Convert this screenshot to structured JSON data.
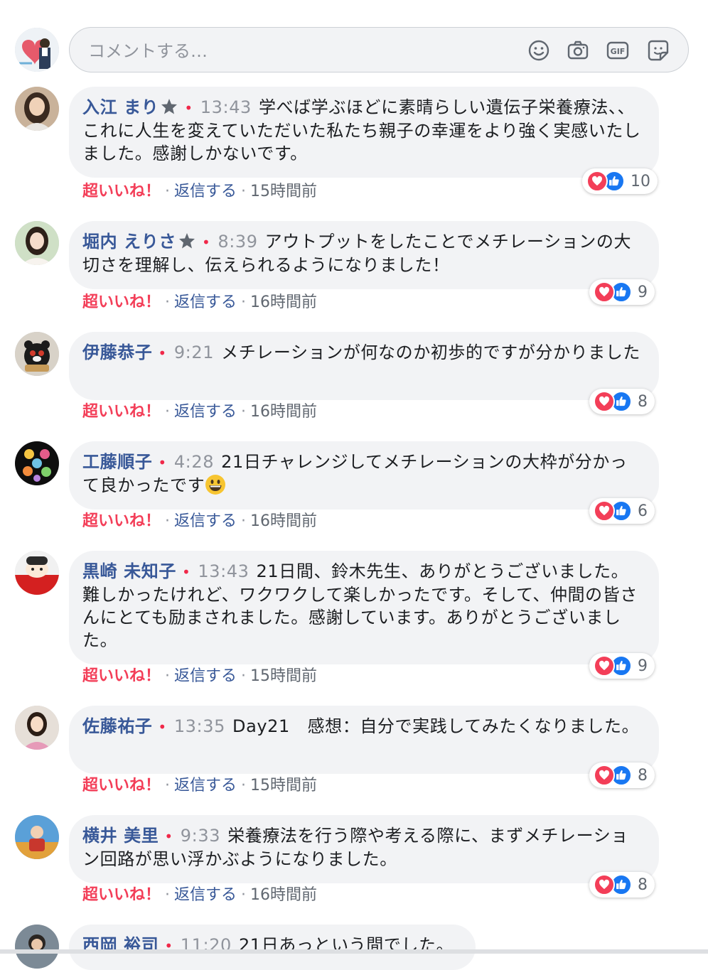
{
  "composer": {
    "placeholder": "コメントする…"
  },
  "comments": [
    {
      "name": "入江 まり",
      "time": "13:43",
      "text": "学べば学ぶほどに素晴らしい遺伝子栄養療法、、これに人生を変えていただいた私たち親子の幸運をより強く実感いたしました。感謝しかないです。",
      "love_label": "超いいね！",
      "reply_label": "返信する",
      "ago": "15時間前",
      "reaction_count": "10"
    },
    {
      "name": "堀内 えりさ",
      "time": "8:39",
      "text": "アウトプットをしたことでメチレーションの大切さを理解し、伝えられるようになりました！",
      "love_label": "超いいね！",
      "reply_label": "返信する",
      "ago": "16時間前",
      "reaction_count": "9"
    },
    {
      "name": "伊藤恭子",
      "time": "9:21",
      "text": "メチレーションが何なのか初歩的ですが分かりました",
      "love_label": "超いいね！",
      "reply_label": "返信する",
      "ago": "16時間前",
      "reaction_count": "8"
    },
    {
      "name": "工藤順子",
      "time": "4:28",
      "text": "21日チャレンジしてメチレーションの大枠が分かって良かったです",
      "love_label": "超いいね！",
      "reply_label": "返信する",
      "ago": "16時間前",
      "reaction_count": "6"
    },
    {
      "name": "黒崎 未知子",
      "time": "13:43",
      "text": "21日間、鈴木先生、ありがとうございました。難しかったけれど、ワクワクして楽しかったです。そして、仲間の皆さんにとても励まされました。感謝しています。ありがとうございました。",
      "love_label": "超いいね！",
      "reply_label": "返信する",
      "ago": "15時間前",
      "reaction_count": "9"
    },
    {
      "name": "佐藤祐子",
      "time": "13:35",
      "text": "Day21　感想：自分で実践してみたくなりました。",
      "love_label": "超いいね！",
      "reply_label": "返信する",
      "ago": "15時間前",
      "reaction_count": "8"
    },
    {
      "name": "横井 美里",
      "time": "9:33",
      "text": "栄養療法を行う際や考える際に、まずメチレーション回路が思い浮かぶようになりました。",
      "love_label": "超いいね！",
      "reply_label": "返信する",
      "ago": "16時間前",
      "reaction_count": "8"
    },
    {
      "name": "西岡 裕司",
      "time": "11:20",
      "text": "21日あっという間でした。"
    }
  ]
}
